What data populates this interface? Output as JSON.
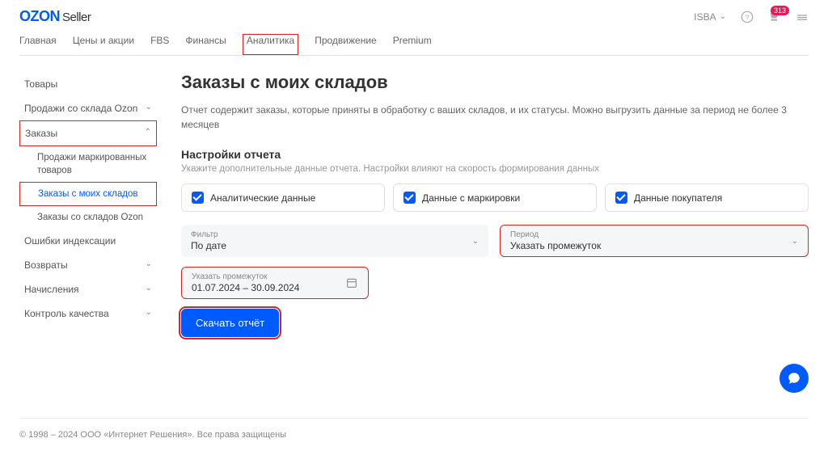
{
  "header": {
    "logo_brand": "OZON",
    "logo_sub": "Seller",
    "account": "ISBA",
    "notif_count": "313"
  },
  "nav": {
    "items": [
      "Главная",
      "Цены и акции",
      "FBS",
      "Финансы",
      "Аналитика",
      "Продвижение",
      "Premium"
    ]
  },
  "sidebar": {
    "i0": "Товары",
    "i1": "Продажи со склада Ozon",
    "i2": "Заказы",
    "i2s0": "Продажи маркированных товаров",
    "i2s1": "Заказы с моих складов",
    "i2s2": "Заказы со складов Ozon",
    "i3": "Ошибки индексации",
    "i4": "Возвраты",
    "i5": "Начисления",
    "i6": "Контроль качества"
  },
  "page": {
    "title": "Заказы с моих складов",
    "desc": "Отчет содержит заказы, которые приняты в обработку с ваших складов, и их статусы. Можно выгрузить данные за период не более 3 месяцев",
    "settings_title": "Настройки отчета",
    "settings_hint": "Укажите дополнительные данные отчета. Настройки влияют на скорость формирования данных",
    "checks": {
      "c0": "Аналитические данные",
      "c1": "Данные с маркировки",
      "c2": "Данные покупателя"
    },
    "filter_label": "Фильтр",
    "filter_value": "По дате",
    "period_label": "Период",
    "period_value": "Указать промежуток",
    "date_label": "Указать промежуток",
    "date_value": "01.07.2024 – 30.09.2024",
    "btn": "Скачать отчёт"
  },
  "footer": "© 1998 – 2024 ООО «Интернет Решения». Все права защищены"
}
